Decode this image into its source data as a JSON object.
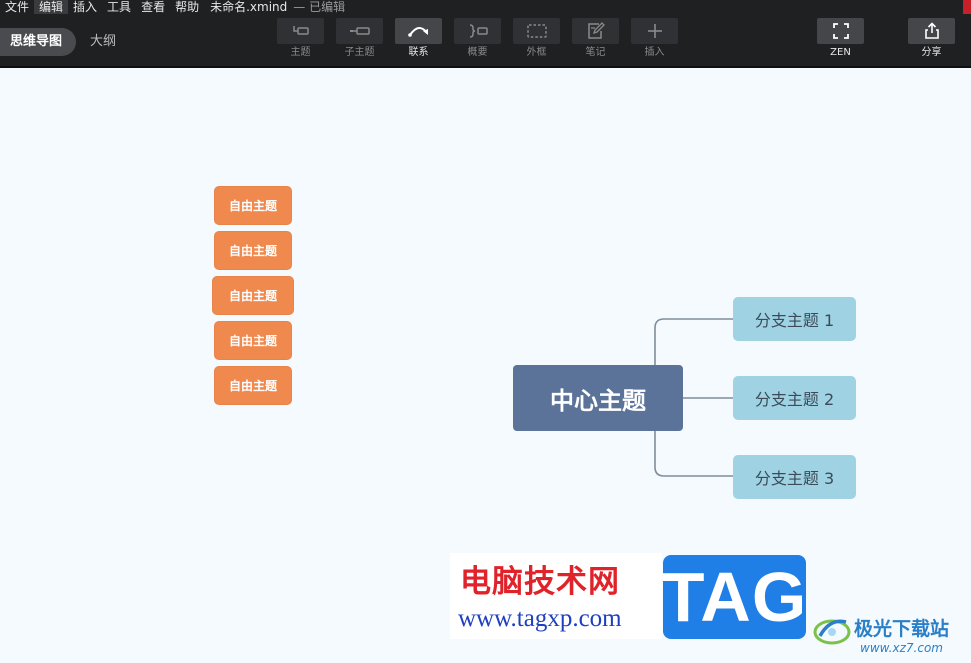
{
  "menubar": {
    "items": [
      {
        "label": "文件"
      },
      {
        "label": "编辑",
        "active": true
      },
      {
        "label": "插入"
      },
      {
        "label": "工具"
      },
      {
        "label": "查看"
      },
      {
        "label": "帮助"
      }
    ],
    "doc_title": "未命名.xmind",
    "doc_status": "— 已编辑"
  },
  "view_switch": {
    "mindmap_label": "思维导图",
    "outline_label": "大纲"
  },
  "toolbar": {
    "topic_label": "主题",
    "subtopic_label": "子主题",
    "relationship_label": "联系",
    "summary_label": "概要",
    "boundary_label": "外框",
    "note_label": "笔记",
    "insert_label": "插入",
    "zen_label": "ZEN",
    "share_label": "分享"
  },
  "canvas": {
    "free_topics": [
      "自由主题",
      "自由主题",
      "自由主题",
      "自由主题",
      "自由主题"
    ],
    "central_topic": "中心主题",
    "branches": [
      "分支主题 1",
      "分支主题 2",
      "分支主题 3"
    ]
  },
  "colors": {
    "free_topic": "#f0894e",
    "central_topic": "#5c7399",
    "branch_topic": "#9fd2e3",
    "connector": "#7e8e9c",
    "canvas_bg": "#f4fafd",
    "toolbar_bg": "#1f2022"
  },
  "watermarks": {
    "site_title": "电脑技术网",
    "site_url": "www.tagxp.com",
    "tag_text": "TAG",
    "jg_name": "极光下载站",
    "jg_url": "www.xz7.com"
  }
}
